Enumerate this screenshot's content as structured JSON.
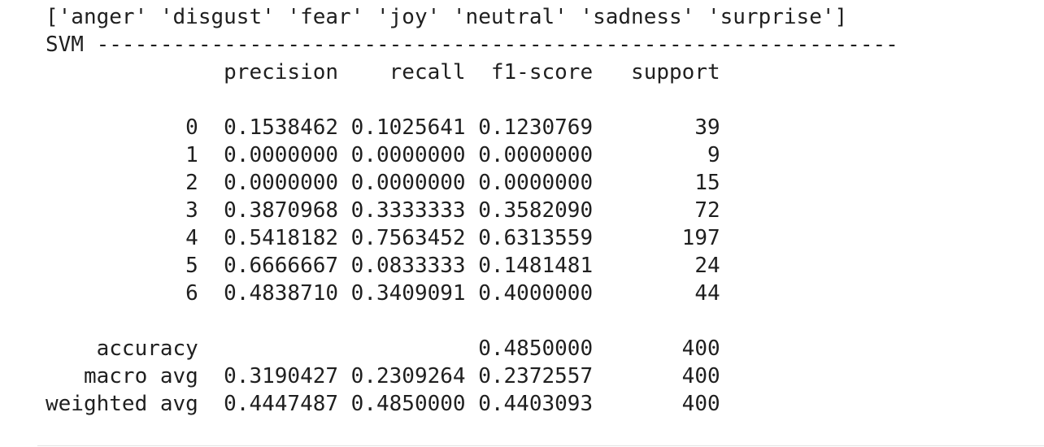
{
  "cell_output": {
    "labels_line": "['anger' 'disgust' 'fear' 'joy' 'neutral' 'sadness' 'surprise']",
    "model_header": "SVM ---------------------------------------------------------------",
    "columns_header": "              precision    recall  f1-score   support",
    "blank_1": "",
    "rows": [
      "           0  0.1538462 0.1025641 0.1230769        39",
      "           1  0.0000000 0.0000000 0.0000000         9",
      "           2  0.0000000 0.0000000 0.0000000        15",
      "           3  0.3870968 0.3333333 0.3582090        72",
      "           4  0.5418182 0.7563452 0.6313559       197",
      "           5  0.6666667 0.0833333 0.1481481        24",
      "           6  0.4838710 0.3409091 0.4000000        44"
    ],
    "blank_2": "",
    "summary": [
      "    accuracy                      0.4850000       400",
      "   macro avg  0.3190427 0.2309264 0.2372557       400",
      "weighted avg  0.4447487 0.4850000 0.4403093       400"
    ]
  }
}
